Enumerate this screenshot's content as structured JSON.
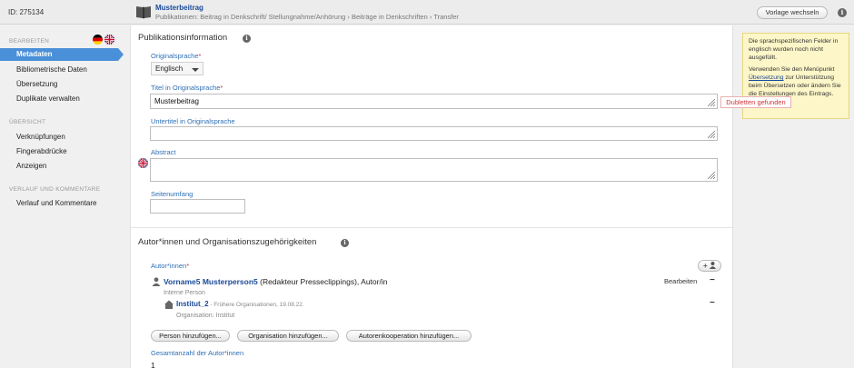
{
  "topbar": {
    "record_id": "ID: 275134",
    "doc_title": "Musterbeitrag",
    "breadcrumb": "Publikationen: Beitrag in Denkschrift/ Stellungnahme/Anhörung › Beiträge in Denkschriften › Transfer",
    "template_button": "Vorlage wechseln",
    "info_glyph": "i"
  },
  "sidebar": {
    "section_edit": "BEARBEITEN",
    "items_edit": [
      "Metadaten",
      "Bibliometrische Daten",
      "Übersetzung",
      "Duplikate verwalten"
    ],
    "section_overview": "ÜBERSICHT",
    "items_overview": [
      "Verknüpfungen",
      "Fingerabdrücke",
      "Anzeigen"
    ],
    "section_history": "VERLAUF UND KOMMENTARE",
    "items_history": [
      "Verlauf und Kommentare"
    ]
  },
  "pubinfo": {
    "title": "Publikationsinformation",
    "original_language_label": "Originalsprache",
    "original_language_value": "Englisch",
    "title_orig_label": "Titel in Originalsprache",
    "title_orig_value": "Musterbeitrag",
    "subtitle_label": "Untertitel in Originalsprache",
    "subtitle_value": "",
    "abstract_label": "Abstract",
    "abstract_value": "",
    "pages_label": "Seitenumfang",
    "pages_value": "",
    "required_mark": "*"
  },
  "duplicates_tooltip": "Dubletten gefunden",
  "authors": {
    "title": "Autor*innen und Organisationszugehörigkeiten",
    "authors_label": "Autor*innen",
    "add_glyph": "+",
    "person_name": "Vorname5 Musterperson5",
    "person_role": " (Redakteur Presseclippings), Autor/in",
    "person_type": "Interne Person",
    "edit_label": "Bearbeiten",
    "org_name": "Institut_2",
    "org_note": " - Frühere Organisationen, 19.08.22.",
    "org_type": "Organisation: Institut",
    "minus": "−",
    "buttons": [
      "Person hinzufügen...",
      "Organisation hinzufügen...",
      "Autorenkooperation hinzufügen..."
    ],
    "total_label": "Gesamtanzahl der Autor*innen",
    "total_value": "1"
  },
  "help": {
    "p1": "Die sprachspezifischen Felder in englisch wurden noch nicht ausgefüllt.",
    "p2_pre": "Verwenden Sie den Menüpunkt ",
    "p2_link": "Übersetzung",
    "p2_post": " zur Unterstützung beim Übersetzen oder ändern Sie die Einstellungen des Eintrags."
  },
  "colors": {
    "accent": "#4a90d9",
    "link": "#1a4a9a",
    "label": "#2e6fb5",
    "required": "#d0343a",
    "help_bg": "#fdf6c8"
  },
  "icons": [
    "book-icon",
    "info-icon",
    "flag-de-icon",
    "flag-uk-icon",
    "person-icon",
    "organization-icon",
    "add-person-icon",
    "resize-grip-icon",
    "dropdown-caret-icon"
  ]
}
